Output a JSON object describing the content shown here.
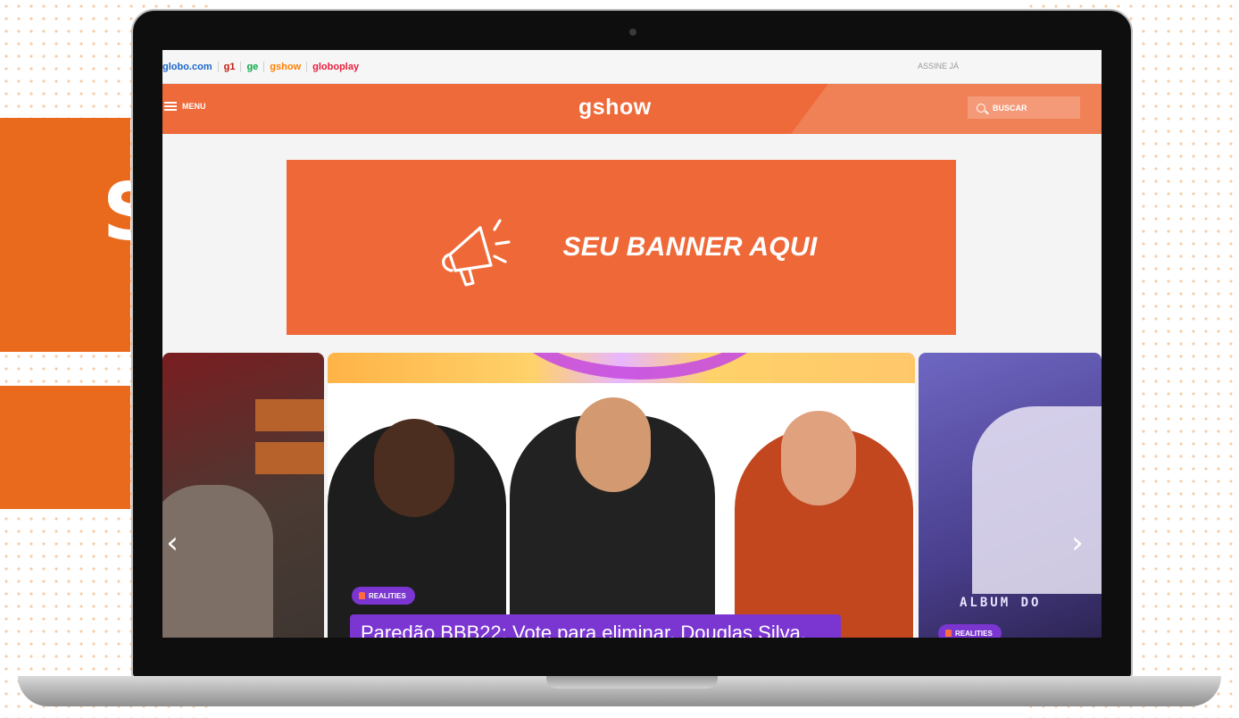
{
  "side": {
    "block1_text": "S",
    "block2_text": "!"
  },
  "topbar": {
    "links": [
      {
        "label": "globo.com",
        "color": "#1a67c9"
      },
      {
        "label": "g1",
        "color": "#c4170c"
      },
      {
        "label": "ge",
        "color": "#06aa48"
      },
      {
        "label": "gshow",
        "color": "#ff7f00"
      },
      {
        "label": "globoplay",
        "color": "#e81e3b"
      }
    ],
    "assine": "ASSINE JÁ"
  },
  "header": {
    "menu_label": "MENU",
    "logo": "gshow",
    "search_label": "BUSCAR",
    "bg_color": "#ef6a3a"
  },
  "banner": {
    "text": "SEU BANNER AQUI",
    "icon": "megaphone-icon"
  },
  "carousel": {
    "main": {
      "category": "REALITIES",
      "headline": "Paredão BBB22: Vote para eliminar, Douglas Silva,"
    },
    "right": {
      "category": "REALITIES",
      "caption": "ALBUM DO"
    }
  }
}
